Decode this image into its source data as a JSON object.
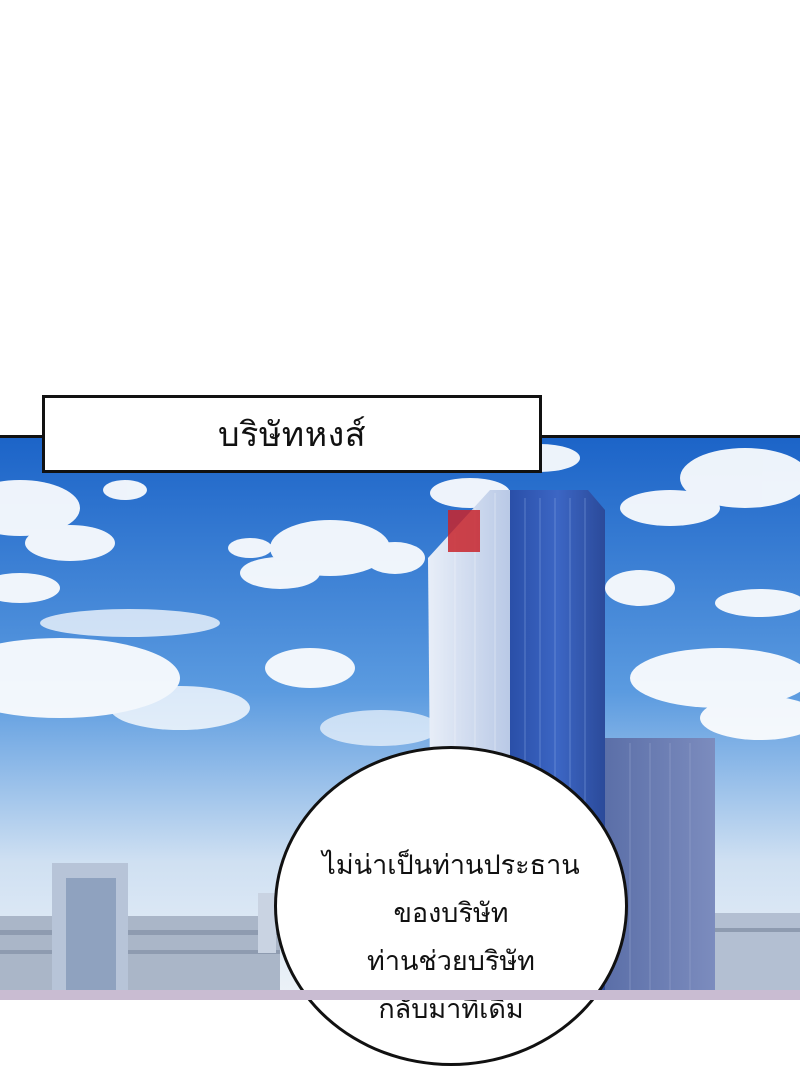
{
  "caption": {
    "text": "บริษัทหงส์"
  },
  "speech_bubble": {
    "lines": [
      "ไม่น่าเป็นท่านประธาน",
      "ของบริษัท",
      "ท่านช่วยบริษัท",
      "กลับมาที่เดิม"
    ]
  },
  "scene": {
    "sky_top": "#1f6fd0",
    "sky_bottom": "#e6eef7",
    "tower_color": "#3b5fb8"
  }
}
